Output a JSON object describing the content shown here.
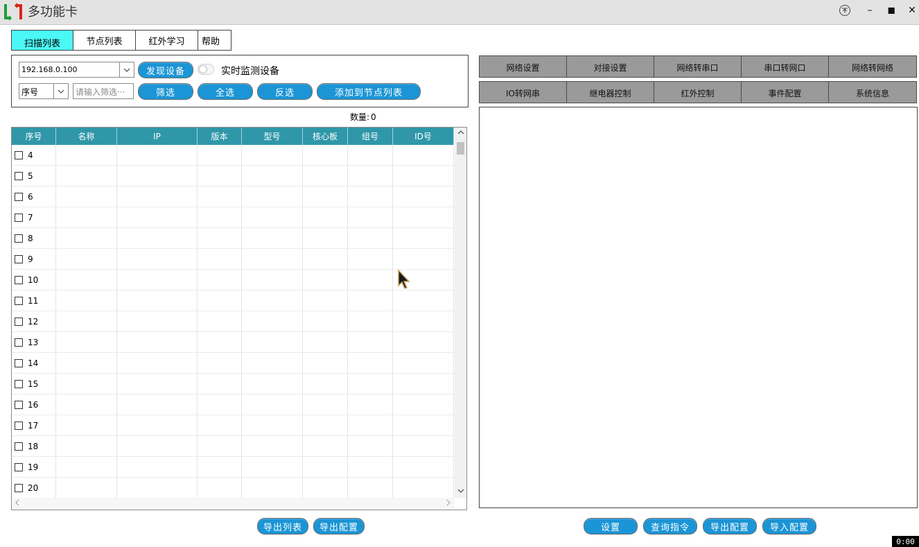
{
  "window": {
    "title": "多功能卡",
    "pin_glyph": "⊼",
    "minimize_glyph": "–",
    "maximize_glyph": "◼",
    "close_glyph": "✕"
  },
  "main_tabs": [
    {
      "label": "扫描列表",
      "active": true
    },
    {
      "label": "节点列表",
      "active": false
    },
    {
      "label": "红外学习",
      "active": false
    },
    {
      "label": "帮助",
      "active": false
    }
  ],
  "search": {
    "ip_value": "192.168.0.100",
    "discover_label": "发现设备",
    "monitor_label": "实时监测设备",
    "monitor_on": false,
    "sort_value": "序号",
    "filter_placeholder": "请输入筛选···",
    "filter_label": "筛选",
    "select_all_label": "全选",
    "invert_label": "反选",
    "add_to_nodes_label": "添加到节点列表"
  },
  "count": {
    "label": "数量:",
    "value": "0"
  },
  "table": {
    "columns": [
      "序号",
      "名称",
      "IP",
      "版本",
      "型号",
      "核心板",
      "组号",
      "ID号"
    ],
    "rows": [
      "4",
      "5",
      "6",
      "7",
      "8",
      "9",
      "10",
      "11",
      "12",
      "13",
      "14",
      "15",
      "16",
      "17",
      "18",
      "19",
      "20"
    ]
  },
  "left_footer": {
    "export_list_label": "导出列表",
    "export_config_label": "导出配置"
  },
  "config_tabs_row1": [
    "网络设置",
    "对接设置",
    "网络转串口",
    "串口转网口",
    "网络转网络"
  ],
  "config_tabs_row2": [
    "IO转网串",
    "继电器控制",
    "红外控制",
    "事件配置",
    "系统信息"
  ],
  "right_footer": {
    "set_label": "设置",
    "query_label": "查询指令",
    "export_config_label": "导出配置",
    "import_config_label": "导入配置"
  },
  "timer": "0:00",
  "colors": {
    "accent_blue": "#1b95d6",
    "header_teal": "#2f97a8",
    "active_tab": "#4af8f5",
    "config_tab_gray": "#9a9a9a",
    "logo_red": "#d9261c",
    "logo_green": "#1d9c3c"
  }
}
